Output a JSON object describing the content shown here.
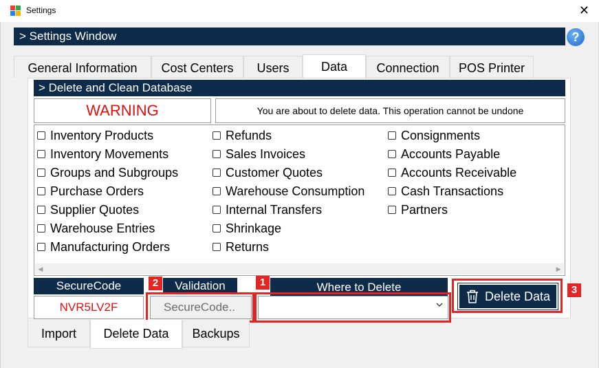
{
  "window": {
    "title": "Settings",
    "close_glyph": "✕"
  },
  "header": {
    "title": "> Settings Window",
    "help_glyph": "?"
  },
  "top_tabs": [
    {
      "label": "General Information"
    },
    {
      "label": "Cost Centers"
    },
    {
      "label": "Users"
    },
    {
      "label": "Data"
    },
    {
      "label": "Connection"
    },
    {
      "label": "POS Printer"
    }
  ],
  "section": {
    "title": "> Delete and Clean Database"
  },
  "warning": {
    "label": "WARNING",
    "message": "You are about to delete data. This operation cannot be undone"
  },
  "checklist": {
    "col1": [
      "Inventory Products",
      "Inventory Movements",
      "Groups and Subgroups",
      "Purchase Orders",
      "Supplier Quotes",
      "Warehouse Entries",
      "Manufacturing Orders"
    ],
    "col2": [
      "Refunds",
      "Sales Invoices",
      "Customer Quotes",
      "Warehouse Consumption",
      "Internal Transfers",
      "Shrinkage",
      "Returns"
    ],
    "col3": [
      "Consignments",
      "Accounts Payable",
      "Accounts Receivable",
      "Cash Transactions",
      "Partners"
    ]
  },
  "form": {
    "securecode_label": "SecureCode",
    "securecode_value": "NVR5LV2F",
    "validation_label": "Validation",
    "validation_placeholder": "SecureCode..",
    "where_label": "Where to Delete",
    "where_value": ""
  },
  "delete_button": {
    "label": "Delete Data",
    "icon": "trash-icon"
  },
  "annotations": [
    "1",
    "2",
    "3"
  ],
  "bottom_tabs": [
    {
      "label": "Import"
    },
    {
      "label": "Delete Data"
    },
    {
      "label": "Backups"
    }
  ],
  "colors": {
    "navy": "#0e2b4a",
    "warning_red": "#e01010",
    "highlight_red": "#e52424"
  }
}
